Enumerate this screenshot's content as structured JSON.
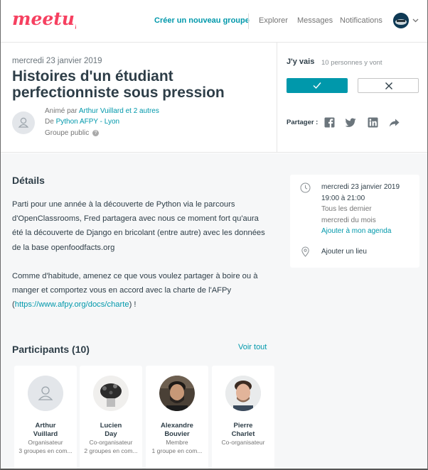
{
  "nav": {
    "create_group": "Créer un nouveau groupe",
    "explore": "Explorer",
    "messages": "Messages",
    "notifications": "Notifications"
  },
  "event": {
    "date": "mercredi 23 janvier 2019",
    "title": "Histoires d'un étudiant perfectionniste sous pression",
    "hosted_prefix": "Animé par",
    "hosted_by": "Arthur Vuillard et 2 autres",
    "group_prefix": "De",
    "group_name": "Python AFPY - Lyon",
    "group_type": "Groupe public"
  },
  "rsvp": {
    "label": "J'y vais",
    "count": "10 personnes y vont",
    "share_label": "Partager :"
  },
  "details": {
    "heading": "Détails",
    "para1": "Parti pour une année à la découverte de Python via le parcours d'OpenClassrooms, Fred partagera avec nous ce moment fort qu'aura été la découverte de Django en bricolant (entre autre) avec les données de la base openfoodfacts.org",
    "para2_before": "Comme d'habitude, amenez ce que vous voulez partager à boire ou à manger et comportez vous en accord avec la charte de l'AFPy (",
    "para2_link": "https://www.afpy.org/docs/charte",
    "para2_after": ") !"
  },
  "sidebar": {
    "date": "mercredi 23 janvier 2019",
    "time": "19:00 à 21:00",
    "recurrence_1": "Tous les dernier",
    "recurrence_2": "mercredi du mois",
    "add_calendar": "Ajouter à mon agenda",
    "location": "Ajouter un lieu"
  },
  "participants": {
    "heading": "Participants (10)",
    "see_all": "Voir tout",
    "items": [
      {
        "first": "Arthur",
        "last": "Vuillard",
        "role": "Organisateur",
        "groups": "3 groupes en com..."
      },
      {
        "first": "Lucien",
        "last": "Day",
        "role": "Co-organisateur",
        "groups": "2 groupes en com..."
      },
      {
        "first": "Alexandre",
        "last": "Bouvier",
        "role": "Membre",
        "groups": "1 groupe en com..."
      },
      {
        "first": "Pierre",
        "last": "Charlet",
        "role": "Co-organisateur",
        "groups": ""
      }
    ]
  },
  "colors": {
    "brand": "#f64060",
    "accent": "#0098ab",
    "text": "#2e3e48",
    "background": "#f6f7f8"
  },
  "icons": [
    "meetup-logo",
    "chevron-down-icon",
    "check-icon",
    "close-icon",
    "facebook-icon",
    "twitter-icon",
    "linkedin-icon",
    "share-arrow-icon",
    "clock-icon",
    "location-pin-icon",
    "user-icon"
  ]
}
